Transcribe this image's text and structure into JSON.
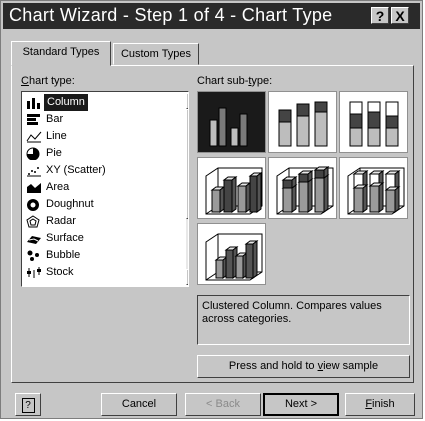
{
  "window": {
    "title": "Chart Wizard - Step 1 of 4 - Chart Type",
    "help_btn": "?",
    "close_btn": "X"
  },
  "tabs": [
    {
      "label": "Standard Types",
      "active": true
    },
    {
      "label": "Custom Types",
      "active": false
    }
  ],
  "chart_type": {
    "label_prefix": "C",
    "label_rest": "hart type:",
    "items": [
      {
        "label": "Column",
        "icon": "column-chart-icon",
        "selected": true
      },
      {
        "label": "Bar",
        "icon": "bar-chart-icon",
        "selected": false
      },
      {
        "label": "Line",
        "icon": "line-chart-icon",
        "selected": false
      },
      {
        "label": "Pie",
        "icon": "pie-chart-icon",
        "selected": false
      },
      {
        "label": "XY (Scatter)",
        "icon": "scatter-chart-icon",
        "selected": false
      },
      {
        "label": "Area",
        "icon": "area-chart-icon",
        "selected": false
      },
      {
        "label": "Doughnut",
        "icon": "doughnut-chart-icon",
        "selected": false
      },
      {
        "label": "Radar",
        "icon": "radar-chart-icon",
        "selected": false
      },
      {
        "label": "Surface",
        "icon": "surface-chart-icon",
        "selected": false
      },
      {
        "label": "Bubble",
        "icon": "bubble-chart-icon",
        "selected": false
      },
      {
        "label": "Stock",
        "icon": "stock-chart-icon",
        "selected": false
      }
    ]
  },
  "sub_type": {
    "label_a": "Chart sub-",
    "label_u": "t",
    "label_b": "ype:",
    "items": [
      {
        "name": "clustered-column",
        "selected": true
      },
      {
        "name": "stacked-column",
        "selected": false
      },
      {
        "name": "100-stacked-column",
        "selected": false
      },
      {
        "name": "3d-clustered-column",
        "selected": false
      },
      {
        "name": "3d-stacked-column",
        "selected": false
      },
      {
        "name": "3d-100-stacked-column",
        "selected": false
      },
      {
        "name": "3d-column",
        "selected": false
      }
    ],
    "description": "Clustered Column. Compares values across categories."
  },
  "buttons": {
    "sample_a": "Press and hold to ",
    "sample_u": "v",
    "sample_b": "iew sample",
    "help": "?",
    "cancel": "Cancel",
    "back": "< Back",
    "next": "Next >",
    "finish_u": "F",
    "finish_b": "inish"
  }
}
